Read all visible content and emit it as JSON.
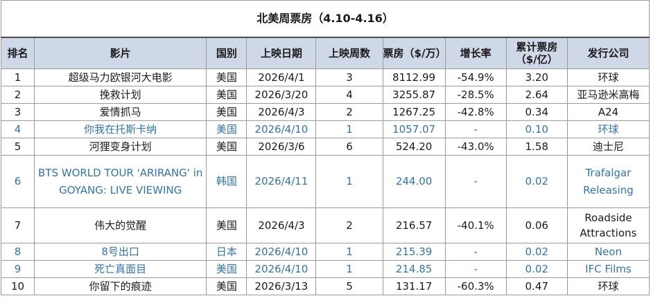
{
  "table": {
    "title": "北美周票房（4.10-4.16）",
    "headers": {
      "rank": "排名",
      "film": "影片",
      "country": "国别",
      "release_date": "上映日期",
      "weeks": "上映周数",
      "box_office": "票房（$/万）",
      "growth": "增长率",
      "cumulative": "累计票房（$/亿）",
      "distributor": "发行公司"
    },
    "rows": [
      {
        "rank": "1",
        "film": "超级马力欧银河大电影",
        "country": "美国",
        "release_date": "2026/4/1",
        "weeks": "3",
        "box_office": "8112.99",
        "growth": "-54.9%",
        "cumulative": "3.20",
        "distributor": "环球",
        "highlight": false
      },
      {
        "rank": "2",
        "film": "挽救计划",
        "country": "美国",
        "release_date": "2026/3/20",
        "weeks": "4",
        "box_office": "3255.87",
        "growth": "-28.5%",
        "cumulative": "2.64",
        "distributor": "亚马逊米高梅",
        "highlight": false
      },
      {
        "rank": "3",
        "film": "爱情抓马",
        "country": "美国",
        "release_date": "2026/4/3",
        "weeks": "2",
        "box_office": "1267.25",
        "growth": "-42.8%",
        "cumulative": "0.34",
        "distributor": "A24",
        "highlight": false
      },
      {
        "rank": "4",
        "film": "你我在托斯卡纳",
        "country": "美国",
        "release_date": "2026/4/10",
        "weeks": "1",
        "box_office": "1057.07",
        "growth": "-",
        "cumulative": "0.10",
        "distributor": "环球",
        "highlight": true
      },
      {
        "rank": "5",
        "film": "河狸变身计划",
        "country": "美国",
        "release_date": "2026/3/6",
        "weeks": "6",
        "box_office": "524.20",
        "growth": "-43.0%",
        "cumulative": "1.58",
        "distributor": "迪士尼",
        "highlight": false
      },
      {
        "rank": "6",
        "film": "BTS WORLD TOUR 'ARIRANG' in GOYANG: LIVE VIEWING",
        "country": "韩国",
        "release_date": "2026/4/11",
        "weeks": "1",
        "box_office": "244.00",
        "growth": "-",
        "cumulative": "0.02",
        "distributor": "Trafalgar Releasing",
        "highlight": true
      },
      {
        "rank": "7",
        "film": "伟大的觉醒",
        "country": "美国",
        "release_date": "2026/4/3",
        "weeks": "2",
        "box_office": "216.57",
        "growth": "-40.1%",
        "cumulative": "0.06",
        "distributor": "Roadside Attractions",
        "highlight": false
      },
      {
        "rank": "8",
        "film": "8号出口",
        "country": "日本",
        "release_date": "2026/4/10",
        "weeks": "1",
        "box_office": "215.39",
        "growth": "-",
        "cumulative": "0.02",
        "distributor": "Neon",
        "highlight": true
      },
      {
        "rank": "9",
        "film": "死亡真面目",
        "country": "美国",
        "release_date": "2026/4/10",
        "weeks": "1",
        "box_office": "214.85",
        "growth": "-",
        "cumulative": "0.02",
        "distributor": "IFC Films",
        "highlight": true
      },
      {
        "rank": "10",
        "film": "你留下的痕迹",
        "country": "美国",
        "release_date": "2026/3/13",
        "weeks": "5",
        "box_office": "131.17",
        "growth": "-60.3%",
        "cumulative": "0.47",
        "distributor": "环球",
        "highlight": false
      }
    ]
  },
  "colors": {
    "header_bg": "#cfd8e6",
    "new_release_text": "#2f74b5",
    "border": "#9a9a9a"
  }
}
